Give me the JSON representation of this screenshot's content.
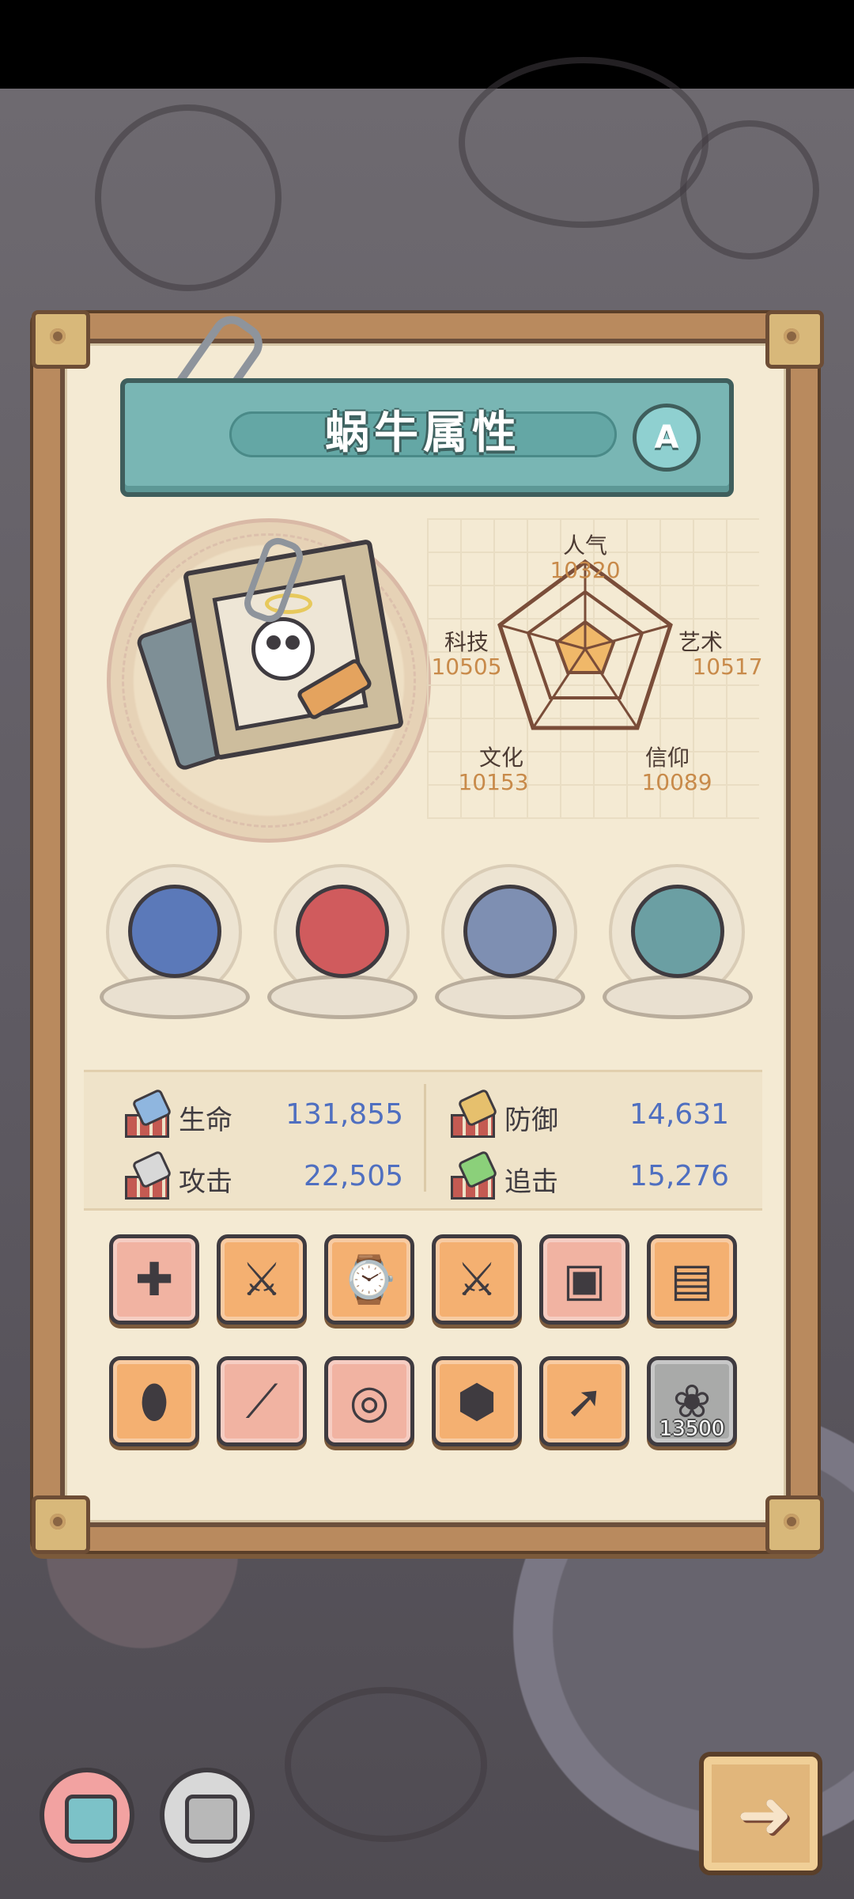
{
  "title": "蜗牛属性",
  "grade": "A",
  "radar": {
    "popularity": {
      "label": "人气",
      "value": "10320"
    },
    "technology": {
      "label": "科技",
      "value": "10505"
    },
    "art": {
      "label": "艺术",
      "value": "10517"
    },
    "culture": {
      "label": "文化",
      "value": "10153"
    },
    "faith": {
      "label": "信仰",
      "value": "10089"
    }
  },
  "pets": [
    "shark-pet-icon",
    "golden-snail-pet-icon",
    "compass-pet-icon",
    "dragon-pet-icon"
  ],
  "stats": {
    "hp": {
      "label": "生命",
      "value": "131,855"
    },
    "defense": {
      "label": "防御",
      "value": "14,631"
    },
    "attack": {
      "label": "攻击",
      "value": "22,505"
    },
    "chase": {
      "label": "追击",
      "value": "15,276"
    }
  },
  "equipment": [
    {
      "name": "gun-icon",
      "color": "pink"
    },
    {
      "name": "twin-blades-icon",
      "color": "orange"
    },
    {
      "name": "watch-icon",
      "color": "orange"
    },
    {
      "name": "crossed-swords-icon",
      "color": "orange"
    },
    {
      "name": "pink-vest-icon",
      "color": "pink"
    },
    {
      "name": "suit-jacket-icon",
      "color": "orange"
    },
    {
      "name": "amulet-icon",
      "color": "orange"
    },
    {
      "name": "blue-sword-icon",
      "color": "pink"
    },
    {
      "name": "necklace-icon",
      "color": "pink"
    },
    {
      "name": "stone-tablet-icon",
      "color": "orange"
    },
    {
      "name": "green-spear-icon",
      "color": "orange"
    },
    {
      "name": "rose-locked-icon",
      "color": "grey",
      "price": "13500"
    }
  ],
  "colors": {
    "title_bar": "#79b6b4",
    "stat_value": "#4f6fc0",
    "radar_value": "#c88a4a",
    "equip_pink": "#f1b3a2",
    "equip_orange": "#f4b071"
  }
}
